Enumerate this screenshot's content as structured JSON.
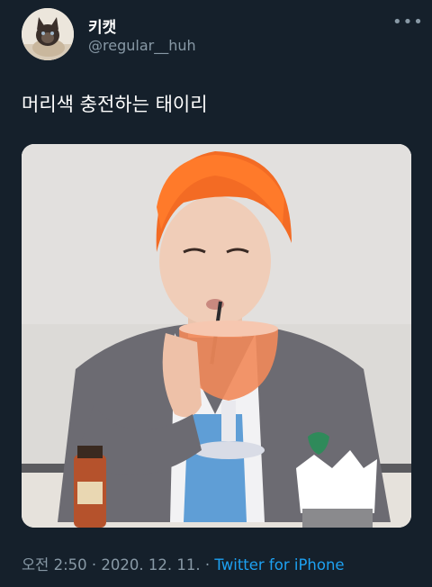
{
  "tweet": {
    "display_name": "키캣",
    "handle": "@regular__huh",
    "more_icon": "more-horizontal-icon",
    "text": "머리색 충전하는 태이리",
    "time": "오전 2:50",
    "separator": " · ",
    "date": "2020. 12. 11.",
    "source": "Twitter for iPhone"
  },
  "colors": {
    "background": "#15202b",
    "secondary_text": "#8899a6",
    "link": "#1da1f2"
  }
}
